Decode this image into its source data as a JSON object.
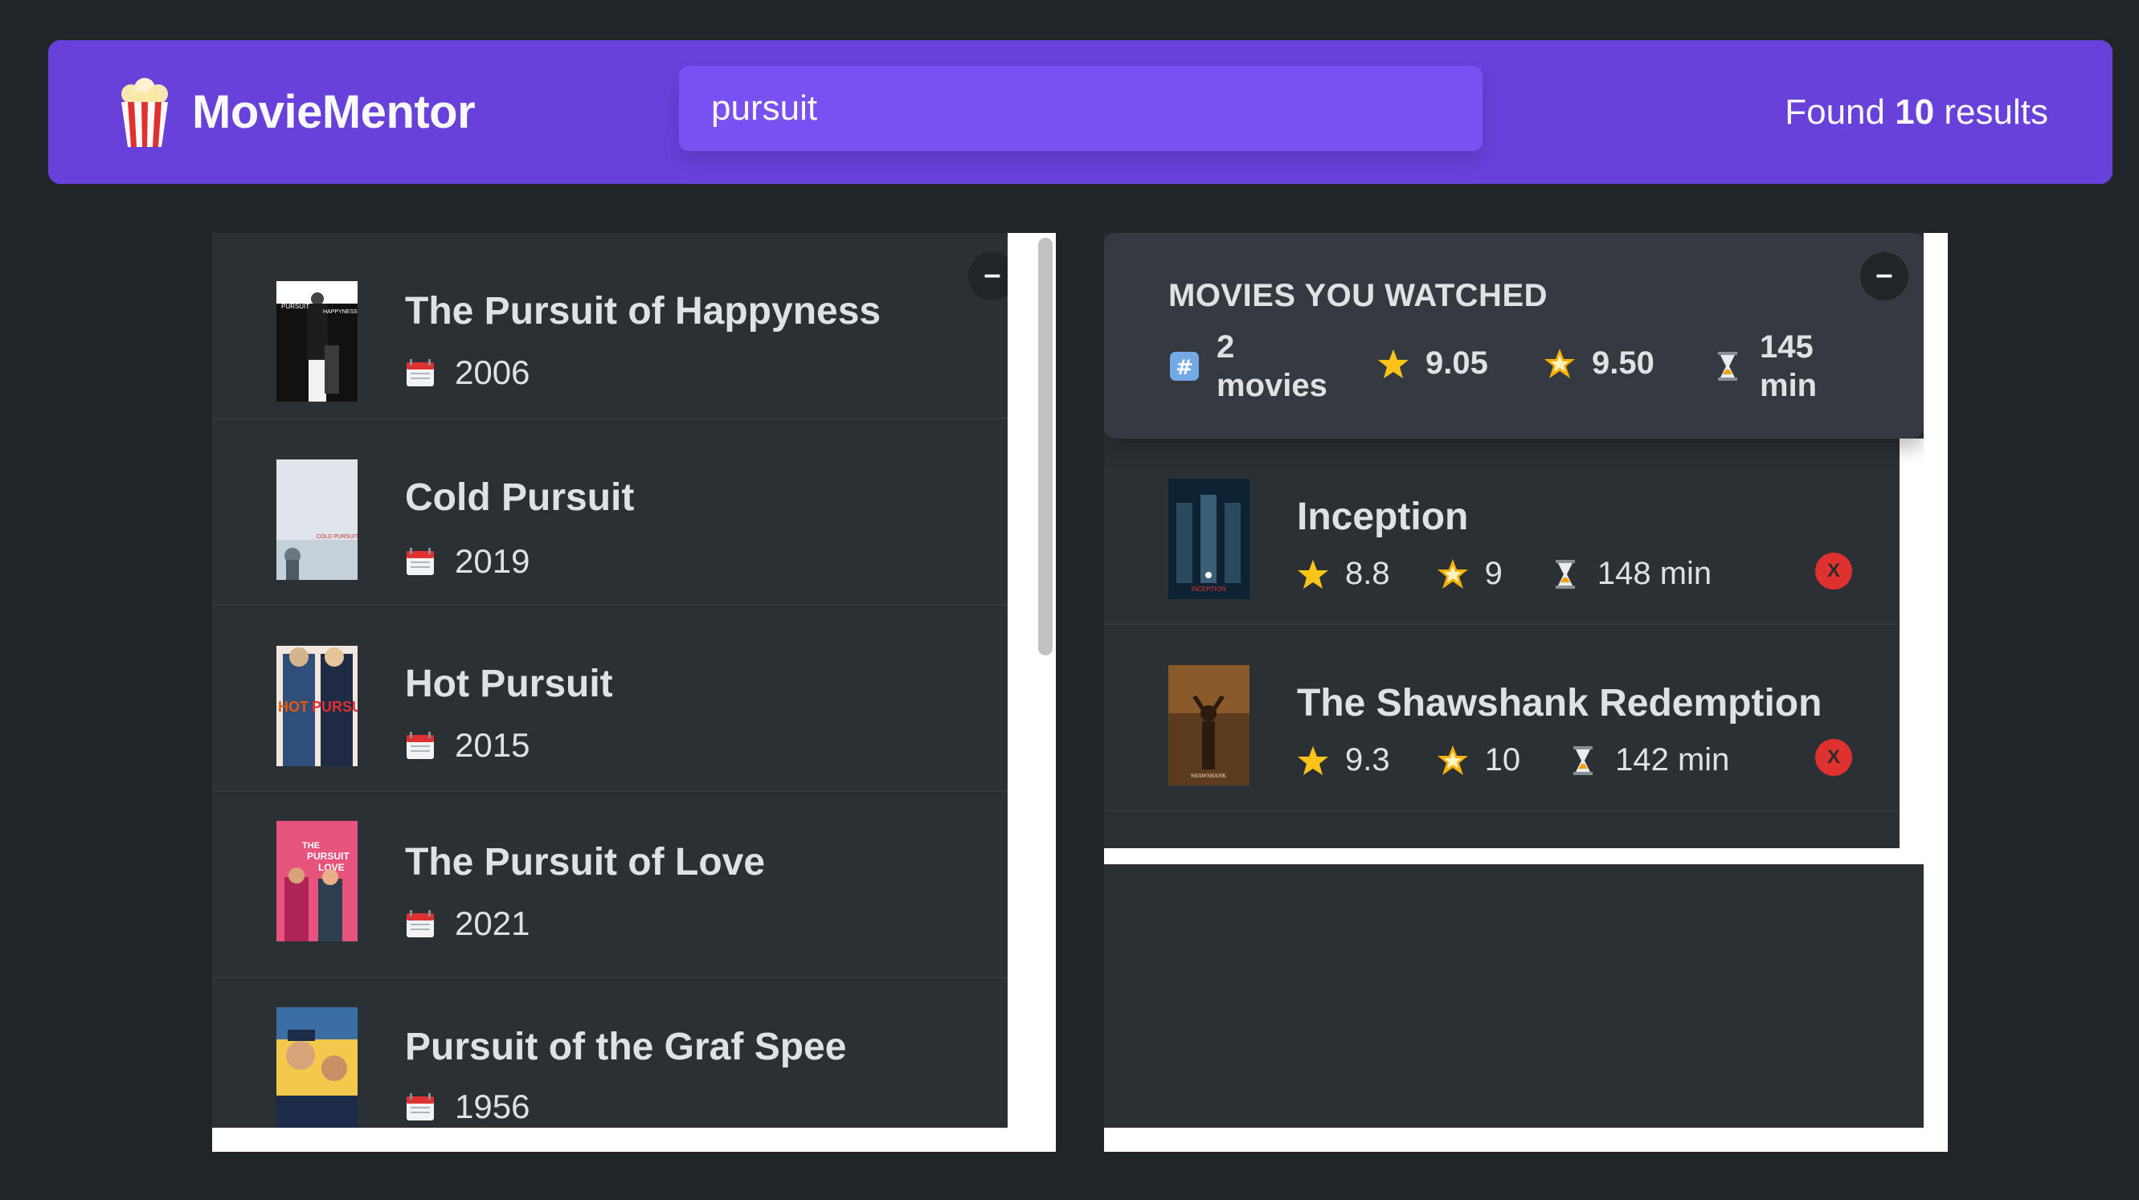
{
  "app": {
    "name": "MovieMentor",
    "logo_icon": "popcorn-icon"
  },
  "search": {
    "value": "pursuit",
    "placeholder": "Search movies..."
  },
  "results": {
    "prefix": "Found",
    "count": "10",
    "suffix": "results"
  },
  "toggle_label": "–",
  "search_list": [
    {
      "title": "The Pursuit of Happyness",
      "year": "2006"
    },
    {
      "title": "Cold Pursuit",
      "year": "2019"
    },
    {
      "title": "Hot Pursuit",
      "year": "2015"
    },
    {
      "title": "The Pursuit of Love",
      "year": "2021"
    },
    {
      "title": "Pursuit of the Graf Spee",
      "year": "1956"
    }
  ],
  "summary": {
    "title": "MOVIES YOU WATCHED",
    "count_value": "2",
    "count_unit": "movies",
    "imdb_avg": "9.05",
    "user_avg": "9.50",
    "runtime_value": "145",
    "runtime_unit": "min"
  },
  "watched": [
    {
      "title": "Inception",
      "imdb": "8.8",
      "user": "9",
      "runtime": "148 min",
      "delete": "X"
    },
    {
      "title": "The Shawshank Redemption",
      "imdb": "9.3",
      "user": "10",
      "runtime": "142 min",
      "delete": "X"
    }
  ],
  "colors": {
    "background": "#212529",
    "nav": "#6741d9",
    "search": "#7950f2",
    "panel": "#2b3035",
    "summary": "#343a40",
    "delete": "#e03131"
  }
}
